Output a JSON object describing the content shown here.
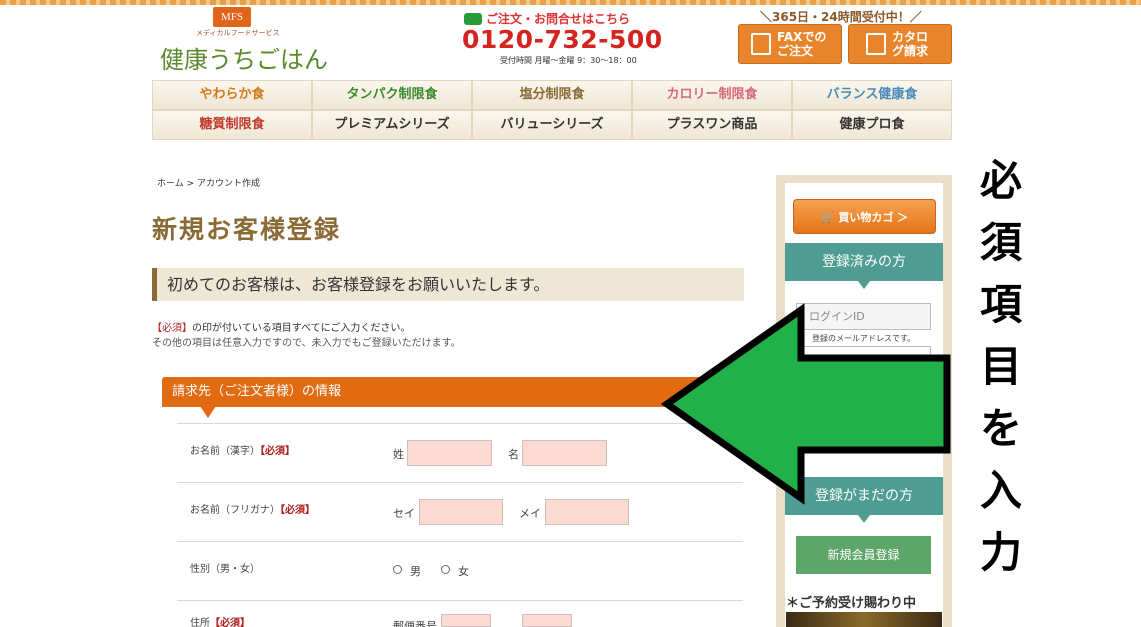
{
  "header": {
    "logo_badge": "MFS",
    "logo_sub": "メディカルフードサービス",
    "logo_text": "健康うちごはん",
    "phone_heading": "ご注文・お問合せはこちら",
    "phone_number": "0120-732-500",
    "phone_hours": "受付時間 月曜〜金曜 9：30〜18：00",
    "hours24": "＼365日・24時間受付中！／",
    "fax_button": "FAXでのご注文",
    "catalog_button": "カタログ請求"
  },
  "nav": {
    "items": [
      {
        "label": "やわらか食",
        "color": "#d07a1c"
      },
      {
        "label": "タンパク制限食",
        "color": "#3c8a2e"
      },
      {
        "label": "塩分制限食",
        "color": "#8a6a35"
      },
      {
        "label": "カロリー制限食",
        "color": "#d46a7a"
      },
      {
        "label": "バランス健康食",
        "color": "#4a8ab8"
      },
      {
        "label": "糖質制限食",
        "color": "#c0392b"
      },
      {
        "label": "プレミアムシリーズ",
        "color": "#333333"
      },
      {
        "label": "バリューシリーズ",
        "color": "#333333"
      },
      {
        "label": "プラスワン商品",
        "color": "#333333"
      },
      {
        "label": "健康プロ食",
        "color": "#333333"
      }
    ]
  },
  "breadcrumb": "ホーム > アカウント作成",
  "page_title": "新規お客様登録",
  "lead": "初めてのお客様は、お客様登録をお願いいたします。",
  "notes": {
    "req_mark": "【必須】",
    "line1_rest": "の印が付いている項目すべてにご入力ください。",
    "line2": "その他の項目は任意入力ですので、未入力でもご登録いただけます。"
  },
  "section": {
    "title": "請求先（ご注文者様）の情報",
    "required": "【必須】",
    "rows": {
      "name_kanji": "お名前（漢字）",
      "last": "姓",
      "first": "名",
      "name_kana": "お名前（フリガナ）",
      "sei": "セイ",
      "mei": "メイ",
      "gender": "性別（男・女）",
      "male": "男",
      "female": "女",
      "address": "住所",
      "postal": "郵便番号"
    }
  },
  "sidebar": {
    "cart": "買い物カゴ ＞",
    "registered": "登録済みの方",
    "login_placeholder": "ログインID",
    "login_note": "登録のメールアドレスです。",
    "not_registered": "登録がまだの方",
    "new_member": "新規会員登録",
    "reserve": "＊ご予約受け賜わり中"
  },
  "overlay": {
    "vertical_text": [
      "必",
      "須",
      "項",
      "目",
      "を",
      "入",
      "力"
    ],
    "arrow_color": "#22b04a"
  }
}
